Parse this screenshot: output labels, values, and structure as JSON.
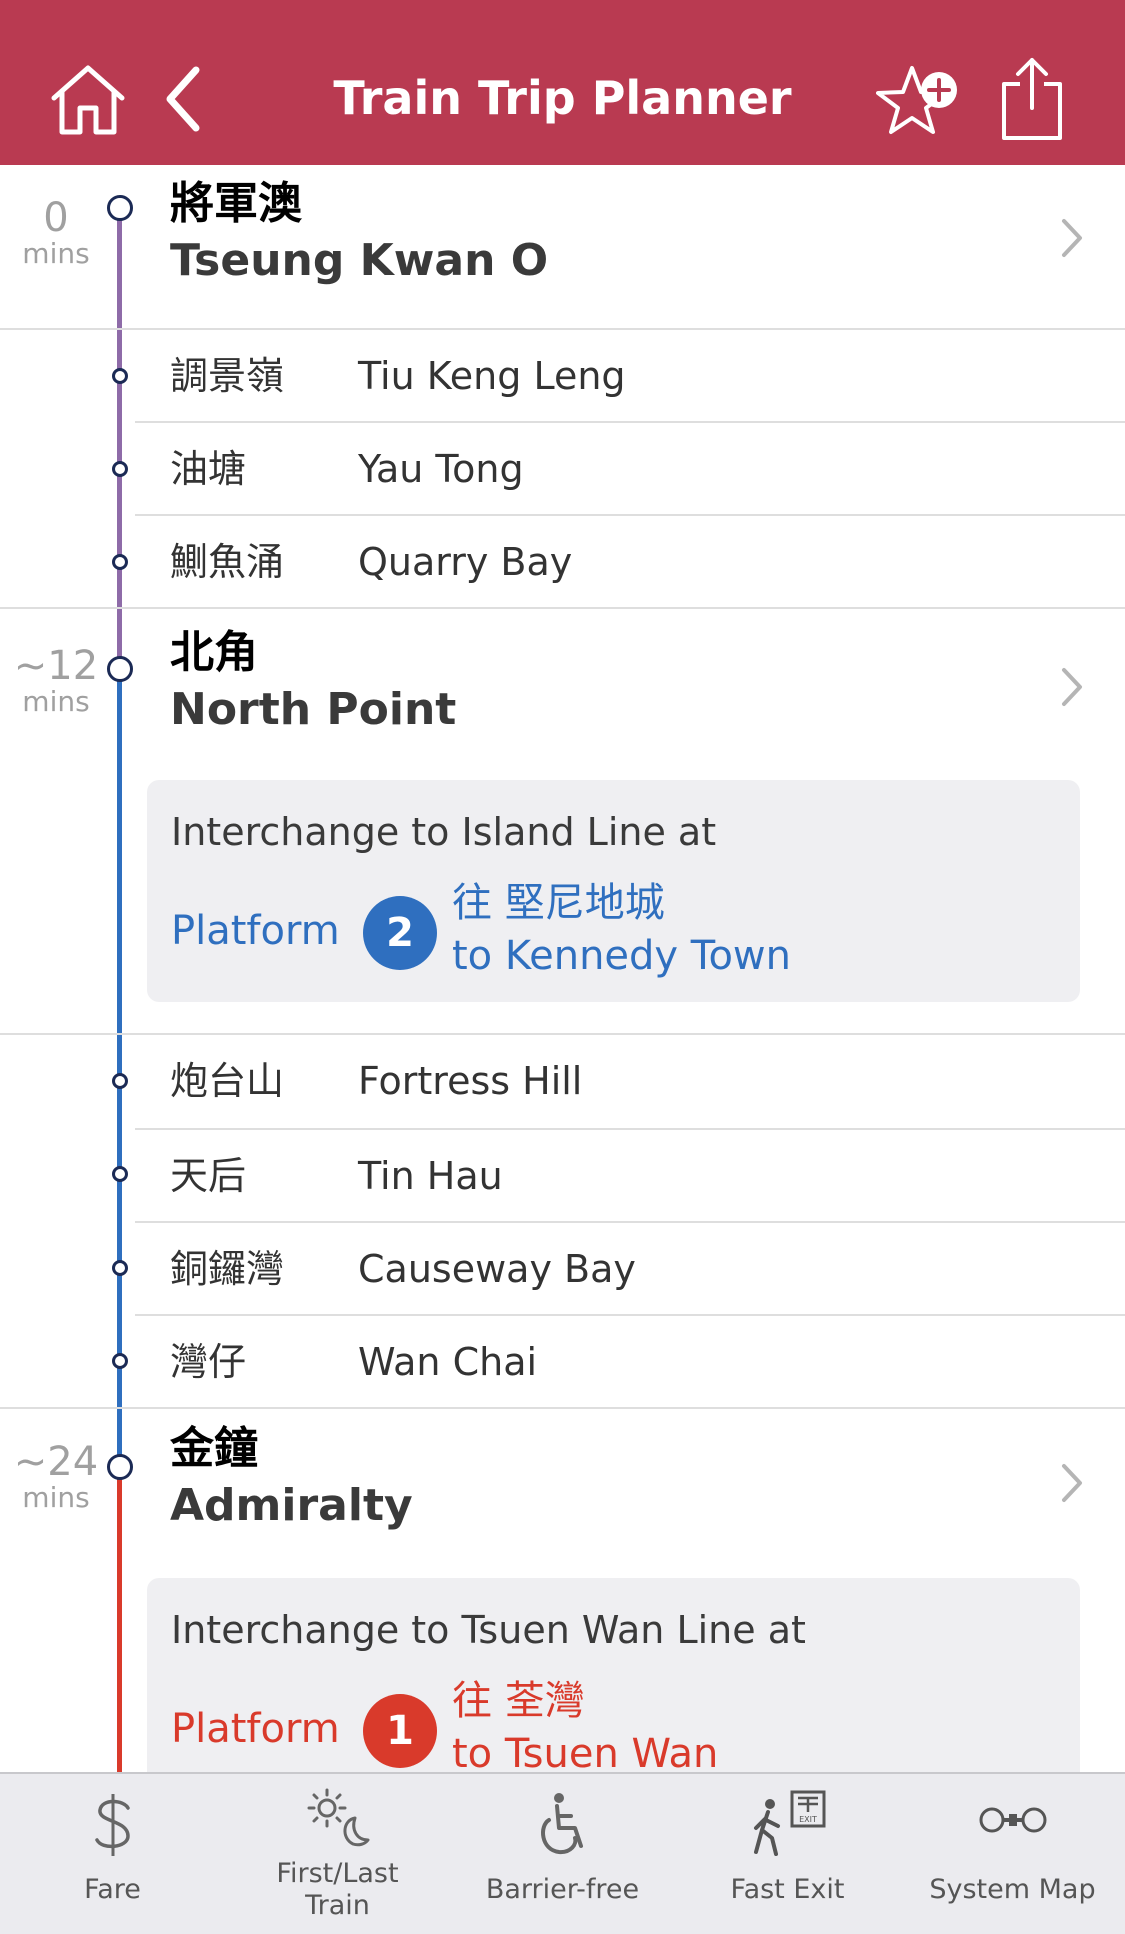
{
  "header": {
    "title": "Train Trip Planner",
    "icons": [
      "home-icon",
      "back-chevron-icon",
      "star-add-icon",
      "share-icon"
    ],
    "background": "#b93a51"
  },
  "colors": {
    "tko_line": "#8e6ba8",
    "island_line": "#2f6fbf",
    "tsuen_wan_line": "#d93a2b",
    "node_border": "#1b2a55",
    "mins_text": "#a0a0a0"
  },
  "stations": {
    "tko": {
      "mins_num": "0",
      "mins_unit": "mins",
      "zh": "將軍澳",
      "en": "Tseung Kwan O"
    },
    "tkl": {
      "zh": "調景嶺",
      "en": "Tiu Keng Leng"
    },
    "yt": {
      "zh": "油塘",
      "en": "Yau Tong"
    },
    "qb": {
      "zh": "鰂魚涌",
      "en": "Quarry Bay"
    },
    "np": {
      "mins_num": "~12",
      "mins_unit": "mins",
      "zh": "北角",
      "en": "North Point"
    },
    "fh": {
      "zh": "炮台山",
      "en": "Fortress Hill"
    },
    "th": {
      "zh": "天后",
      "en": "Tin Hau"
    },
    "cwb": {
      "zh": "銅鑼灣",
      "en": "Causeway Bay"
    },
    "wc": {
      "zh": "灣仔",
      "en": "Wan Chai"
    },
    "adm": {
      "mins_num": "~24",
      "mins_unit": "mins",
      "zh": "金鐘",
      "en": "Admiralty"
    }
  },
  "interchanges": {
    "np": {
      "text": "Interchange to Island Line at",
      "platform_label": "Platform",
      "platform_number": "2",
      "dest_zh": "往 堅尼地城",
      "dest_en": "to Kennedy Town",
      "color": "#2f6fbf"
    },
    "adm": {
      "text": "Interchange to Tsuen Wan Line at",
      "platform_label": "Platform",
      "platform_number": "1",
      "dest_zh": "往 荃灣",
      "dest_en": "to Tsuen Wan",
      "color": "#d93a2b"
    }
  },
  "tabbar": {
    "fare": {
      "label": "Fare",
      "icon": "dollar-icon"
    },
    "first_last": {
      "label_line1": "First/Last",
      "label_line2": "Train",
      "icon": "sun-moon-icon"
    },
    "barrier_free": {
      "label": "Barrier-free",
      "icon": "wheelchair-icon"
    },
    "fast_exit": {
      "label": "Fast Exit",
      "icon": "exit-walker-icon"
    },
    "system_map": {
      "label": "System Map",
      "icon": "system-map-icon"
    }
  }
}
